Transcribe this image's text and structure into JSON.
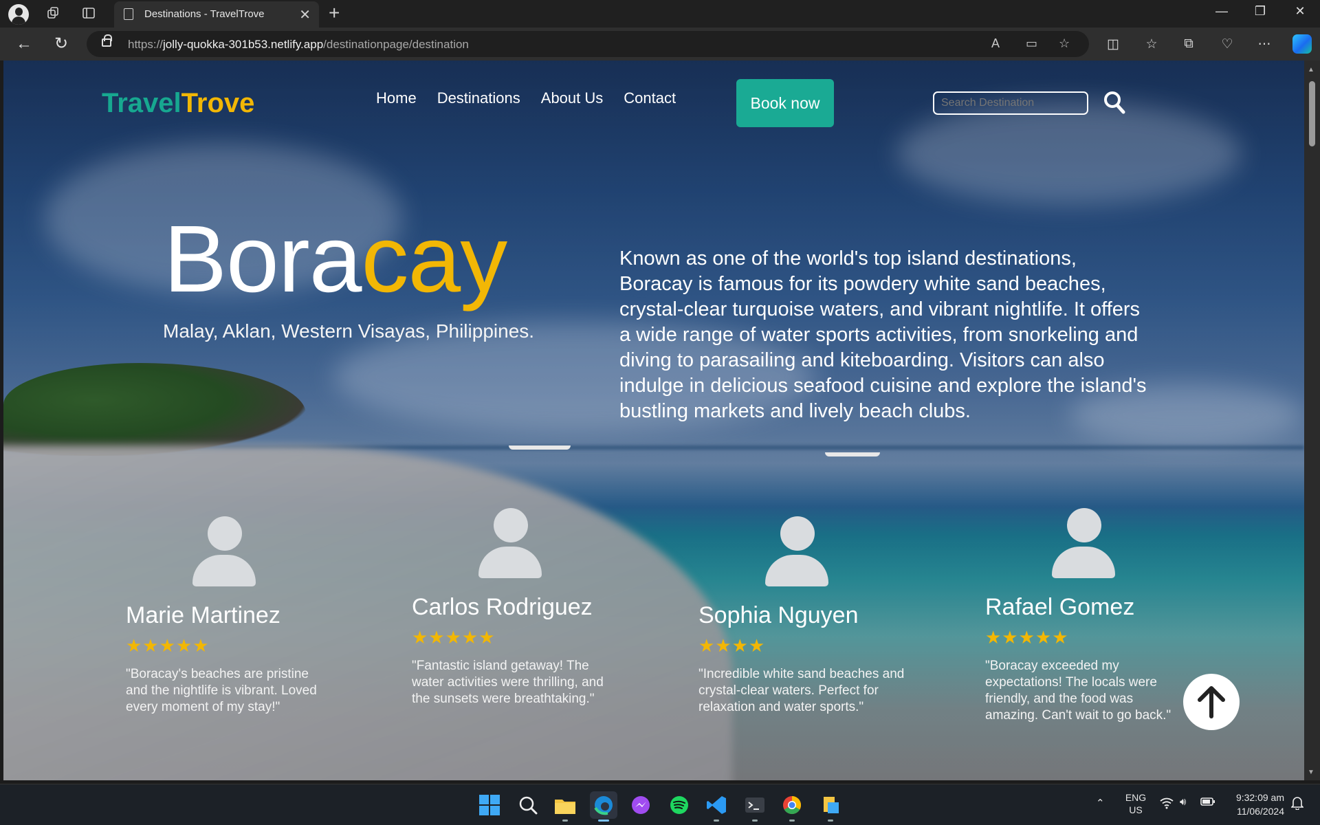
{
  "browser": {
    "tab_title": "Destinations - TravelTrove",
    "url_prefix": "https://",
    "url_host": "jolly-quokka-301b53.netlify.app",
    "url_path": "/destinationpage/destination"
  },
  "site": {
    "logo_part1": "Travel",
    "logo_part2": "Trove",
    "nav": [
      "Home",
      "Destinations",
      "About Us",
      "Contact"
    ],
    "book_now": "Book now",
    "search_placeholder": "Search Destination"
  },
  "hero": {
    "title_part1": "Bora",
    "title_part2": "cay",
    "location": "Malay, Aklan, Western Visayas, Philippines.",
    "description": "Known as one of the world's top island destinations, Boracay is famous for its powdery white sand beaches, crystal-clear turquoise waters, and vibrant nightlife. It offers a wide range of water sports activities, from snorkeling and diving to parasailing and kiteboarding. Visitors can also indulge in delicious seafood cuisine and explore the island's bustling markets and lively beach clubs."
  },
  "reviews": [
    {
      "name": "Marie Martinez",
      "stars": "★★★★★",
      "rating": 5,
      "text": "\"Boracay's beaches are pristine and the nightlife is vibrant. Loved every moment of my stay!\""
    },
    {
      "name": "Carlos Rodriguez",
      "stars": "★★★★★",
      "rating": 5,
      "text": "\"Fantastic island getaway! The water activities were thrilling, and the sunsets were breathtaking.\""
    },
    {
      "name": "Sophia Nguyen",
      "stars": "★★★★",
      "rating": 4,
      "text": "\"Incredible white sand beaches and crystal-clear waters. Perfect for relaxation and water sports.\""
    },
    {
      "name": "Rafael Gomez",
      "stars": "★★★★★",
      "rating": 5,
      "text": "\"Boracay exceeded my expectations! The locals were friendly, and the food was amazing. Can't wait to go back.\""
    }
  ],
  "colors": {
    "accent_teal": "#1aaa94",
    "accent_yellow": "#f2b705"
  },
  "taskbar": {
    "lang_line1": "ENG",
    "lang_line2": "US",
    "time": "9:32:09 am",
    "date": "11/06/2024"
  }
}
